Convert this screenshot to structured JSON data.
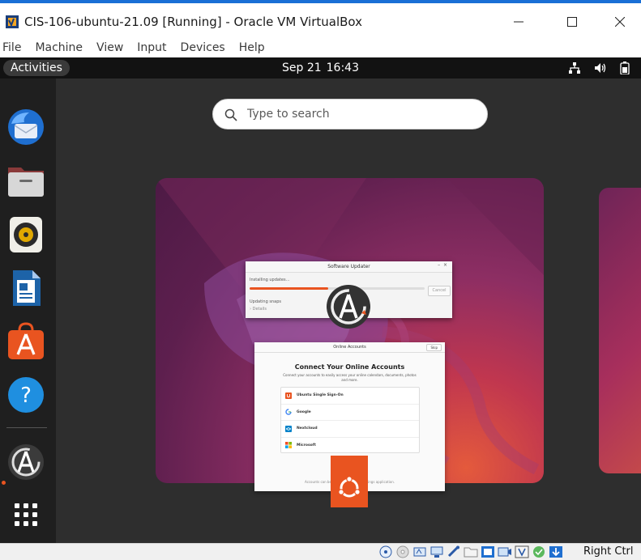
{
  "window": {
    "title": "CIS-106-ubuntu-21.09 [Running] - Oracle VM VirtualBox",
    "icons": [
      "virtualbox-logo-icon",
      "minimize-icon",
      "maximize-icon",
      "close-icon"
    ]
  },
  "menu": {
    "items": [
      "File",
      "Machine",
      "View",
      "Input",
      "Devices",
      "Help"
    ]
  },
  "guest": {
    "activities": "Activities",
    "date": "Sep 21",
    "time": "16:43",
    "tray_icons": [
      "network-icon",
      "volume-icon",
      "battery-icon"
    ],
    "search": {
      "placeholder": "Type to search"
    },
    "dock": [
      "thunderbird-icon",
      "files-icon",
      "rhythmbox-icon",
      "libreoffice-writer-icon",
      "app-center-icon",
      "help-icon",
      "software-updater-icon",
      "show-apps-icon"
    ]
  },
  "updater": {
    "title": "Software Updater",
    "status": "Installing updates…",
    "detail": "Updating snaps",
    "details_link": "› Details",
    "cancel": "Cancel",
    "progress": 0.45
  },
  "accounts": {
    "title": "Online Accounts",
    "skip": "Skip",
    "heading": "Connect Your Online Accounts",
    "description": "Connect your accounts to easily access your online calendars, documents, photos and more.",
    "providers": [
      "Ubuntu Single Sign-On",
      "Google",
      "Nextcloud",
      "Microsoft"
    ],
    "footer": "Accounts can be edited and … the Settings application."
  },
  "statusbar": {
    "host_key": "Right Ctrl"
  },
  "colors": {
    "accent": "#e95420",
    "topbar": "#121212",
    "dock": "#1f1f1f",
    "overview": "#2e2e2e"
  }
}
